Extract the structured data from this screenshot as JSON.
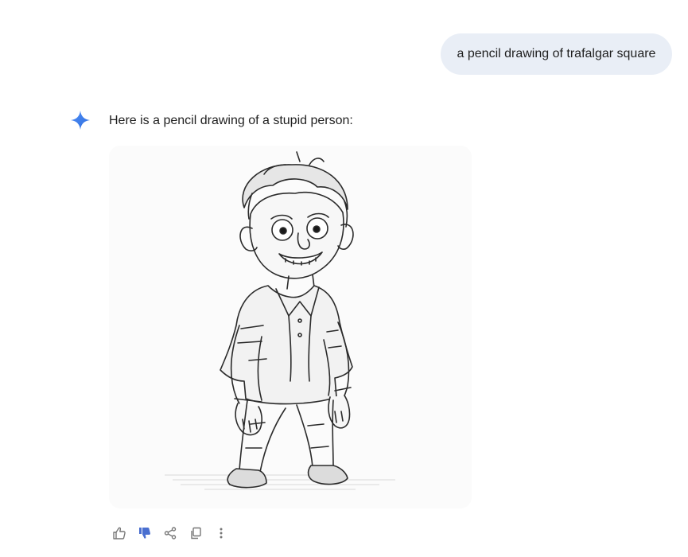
{
  "conversation": {
    "user_message": "a pencil drawing of trafalgar square",
    "assistant_message": "Here is a pencil drawing of a stupid person:"
  },
  "icons": {
    "assistant": "sparkle-icon",
    "actions": [
      "thumbs-up-icon",
      "thumbs-down-icon",
      "share-icon",
      "copy-icon",
      "more-vert-icon"
    ]
  },
  "colors": {
    "user_bubble": "#e9eef6",
    "accent": "#4285f4",
    "icon_gray": "#777777",
    "thumbs_down_active": "#4a6fd0"
  }
}
